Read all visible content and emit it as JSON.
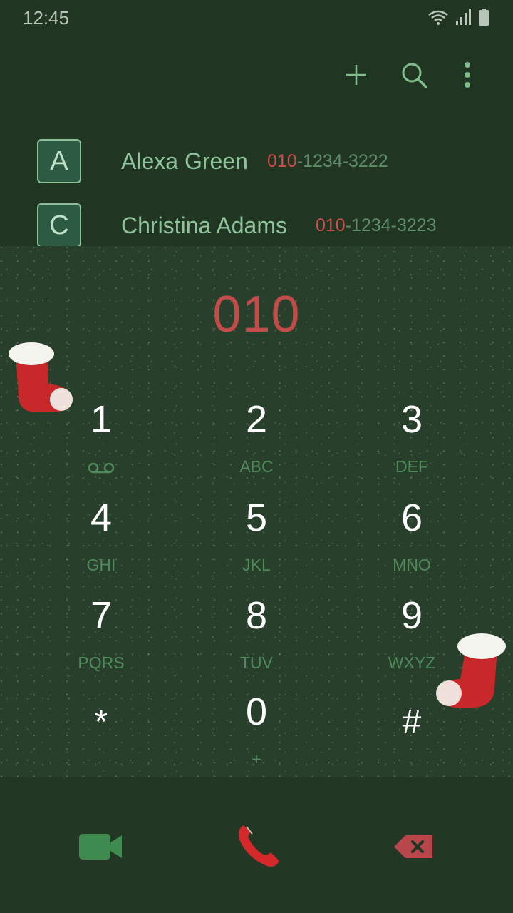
{
  "status_bar": {
    "time": "12:45",
    "icons": [
      "wifi-icon",
      "signal-icon",
      "battery-icon"
    ]
  },
  "toolbar": {
    "icons": [
      "add-icon",
      "search-icon",
      "more-options-icon"
    ]
  },
  "contacts": [
    {
      "initial": "A",
      "name": "Alexa Green",
      "number_match": "010",
      "number_rest": "-1234-3222"
    },
    {
      "initial": "C",
      "name": "Christina Adams",
      "number_match": "010",
      "number_rest": "-1234-3223"
    }
  ],
  "dialer": {
    "input": "010"
  },
  "keys": [
    {
      "digit": "1",
      "letters": "",
      "sub_icon": "voicemail-icon"
    },
    {
      "digit": "2",
      "letters": "ABC"
    },
    {
      "digit": "3",
      "letters": "DEF"
    },
    {
      "digit": "4",
      "letters": "GHI"
    },
    {
      "digit": "5",
      "letters": "JKL"
    },
    {
      "digit": "6",
      "letters": "MNO"
    },
    {
      "digit": "7",
      "letters": "PQRS"
    },
    {
      "digit": "8",
      "letters": "TUV"
    },
    {
      "digit": "9",
      "letters": "WXYZ"
    },
    {
      "digit": "*",
      "letters": ""
    },
    {
      "digit": "0",
      "letters": "+"
    },
    {
      "digit": "#",
      "letters": ""
    }
  ],
  "bottom_bar": {
    "icons": [
      "video-call-icon",
      "call-icon",
      "backspace-icon"
    ]
  },
  "colors": {
    "background": "#203522",
    "accent_red": "#c24c4a",
    "accent_green": "#8fc49b",
    "video_green": "#3f8a4f"
  }
}
